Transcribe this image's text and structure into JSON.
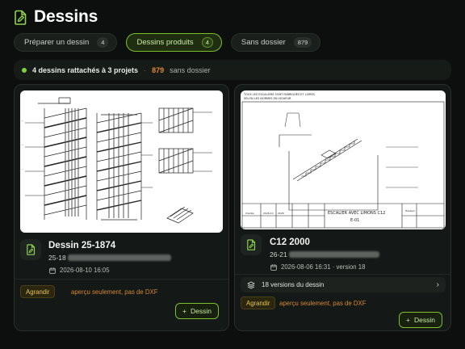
{
  "header": {
    "title": "Dessins",
    "icon": "document-edit-icon",
    "accent": "#8fd14f"
  },
  "tabs": [
    {
      "label": "Préparer un dessin",
      "count": "4",
      "active": false
    },
    {
      "label": "Dessins produits",
      "count": "4",
      "active": true
    },
    {
      "label": "Sans dossier",
      "count": "879",
      "active": false
    }
  ],
  "summary": {
    "main": "4 dessins rattachés à 3 projets",
    "sep": "·",
    "orphan_count": "879",
    "orphan_label": "sans dossier"
  },
  "cards": [
    {
      "name": "Dessin 25-1874",
      "sub_visible": "25-18",
      "date": "2026-08-10 16:05",
      "enlarge_label": "Agrandir",
      "note": "aperçu seulement, pas de DXF",
      "add_label": "Dessin"
    },
    {
      "name": "C12 2000",
      "sub_visible": "26-21",
      "date": "2026-08-06 16:31 · version 18",
      "versions_label": "18 versions du dessin",
      "enlarge_label": "Agrandir",
      "note": "aperçu seulement, pas de DXF",
      "add_label": "Dessin",
      "drawing_title": "ESCALIER AVEC LIMONS C12",
      "drawing_number": "E-01"
    }
  ],
  "colors": {
    "accent_green": "#7bbf2a",
    "orange": "#e1892a",
    "background": "#0c0f0d"
  }
}
